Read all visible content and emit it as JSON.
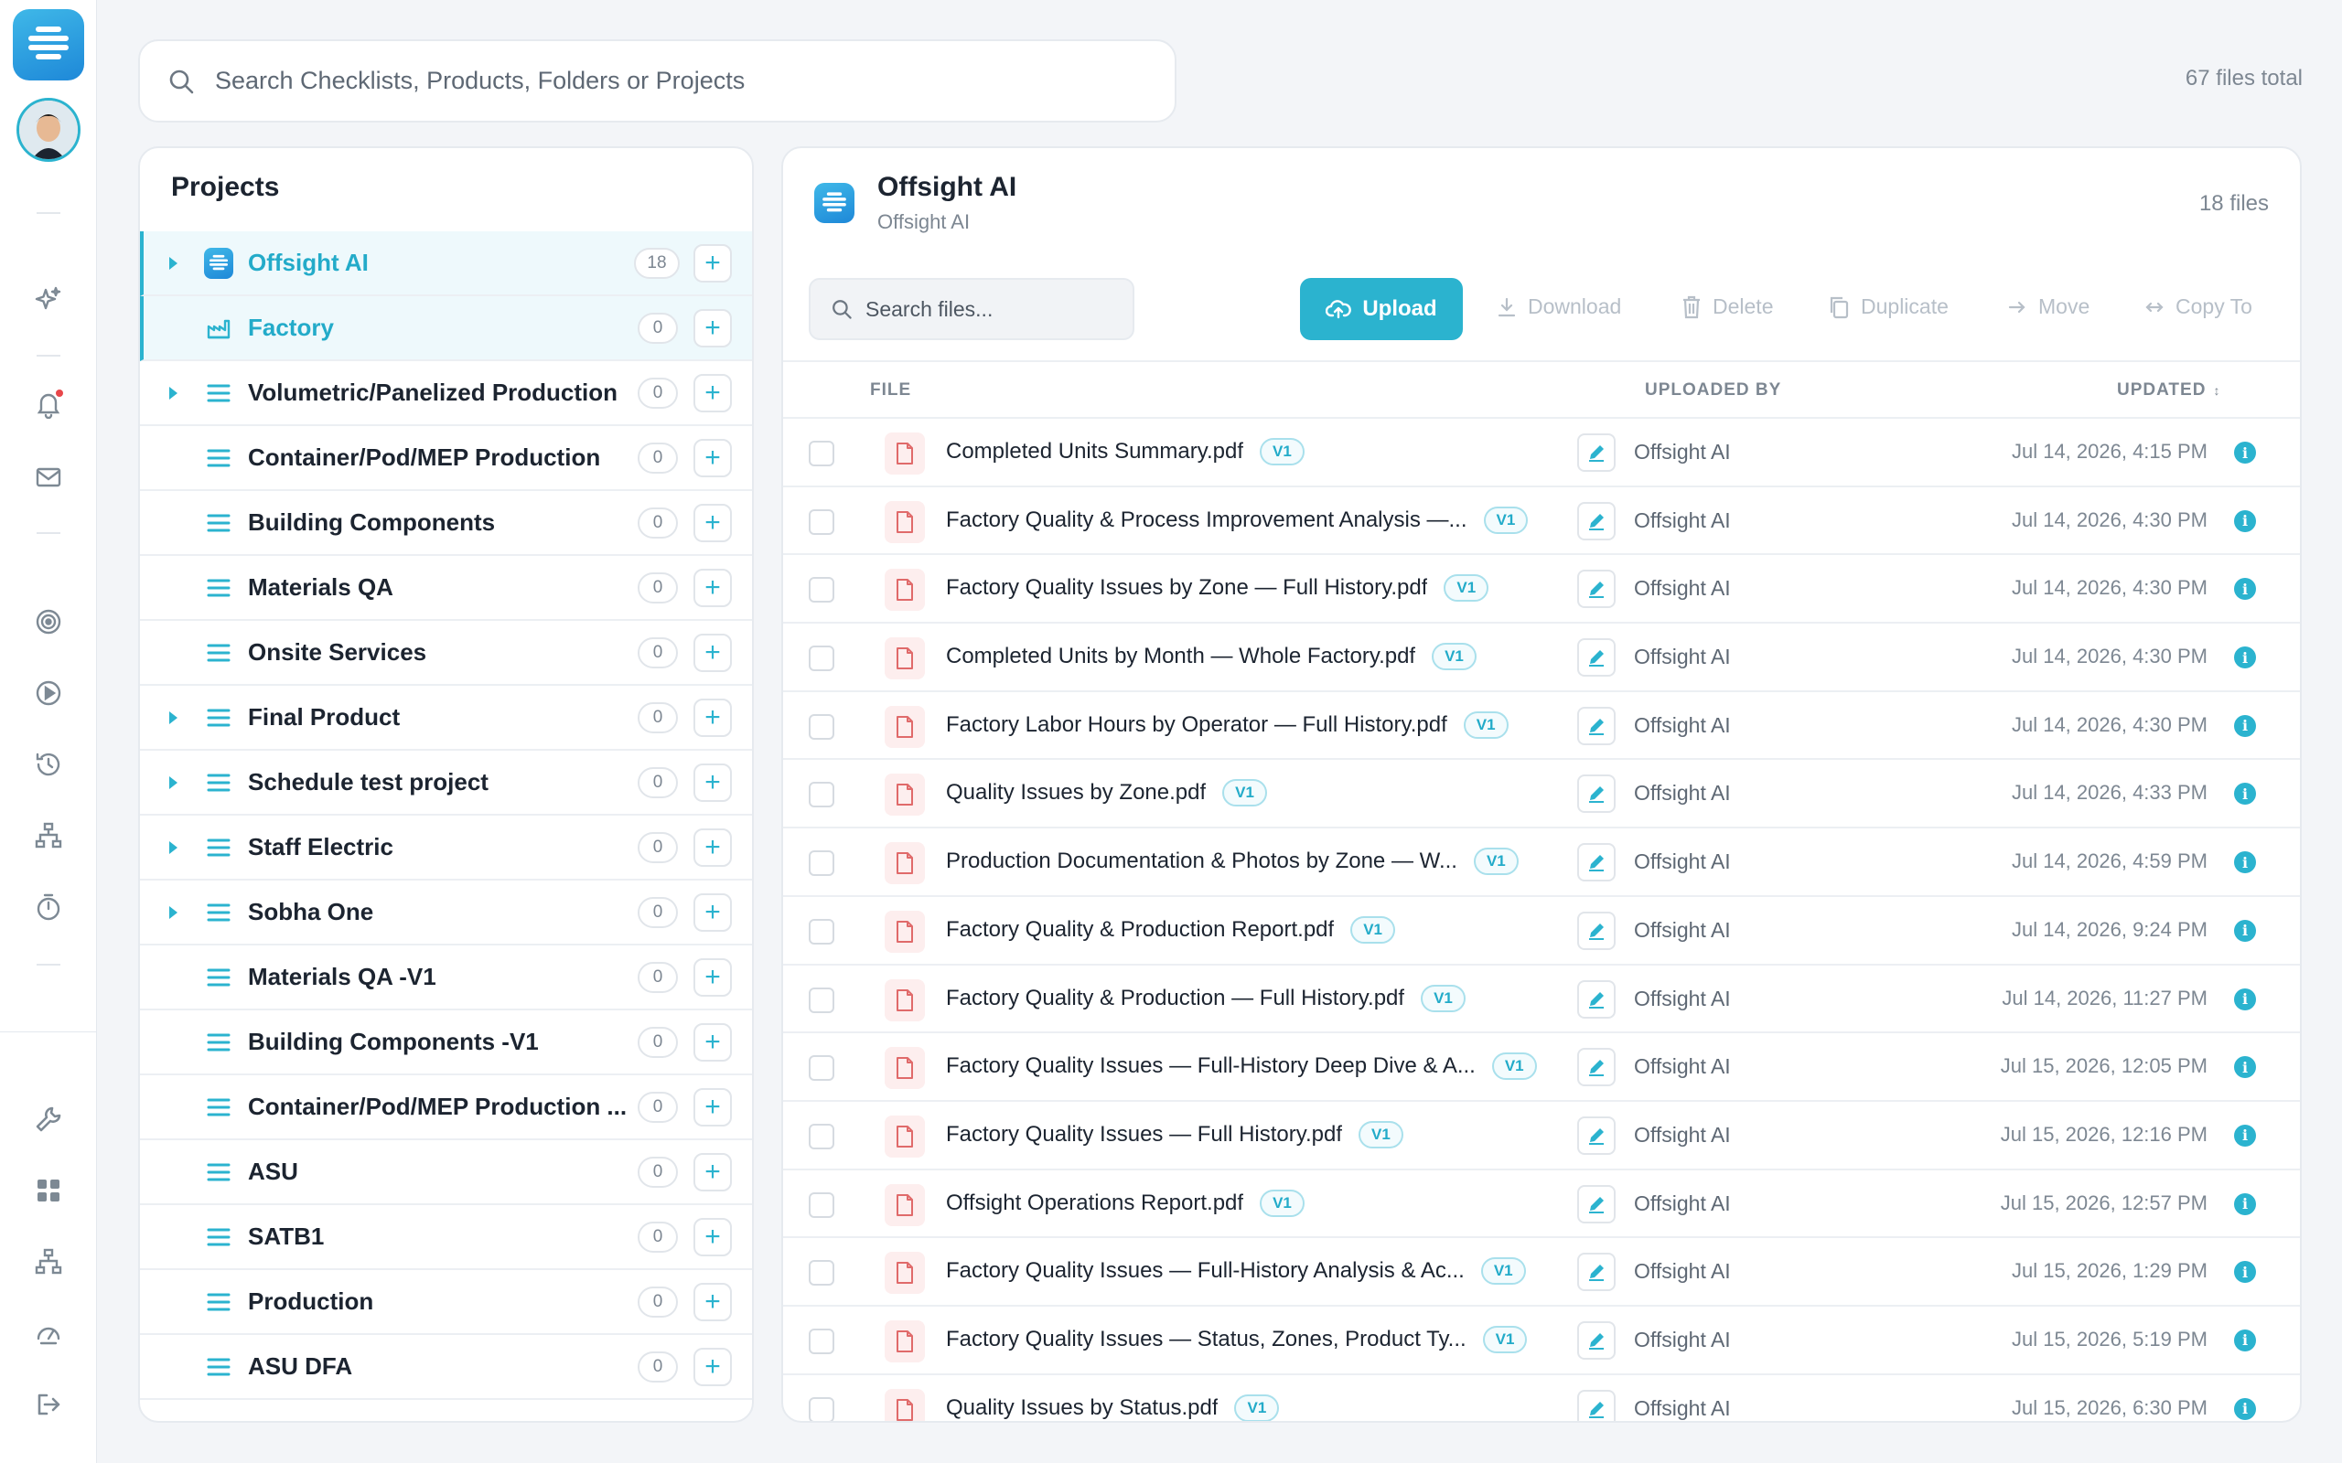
{
  "global_search": {
    "placeholder": "Search Checklists, Products, Folders or Projects"
  },
  "files_total": "67 files total",
  "rail": {
    "icons": [
      "sparkles-icon",
      "bell-icon",
      "mail-icon",
      "target-icon",
      "play-icon",
      "history-icon",
      "org-chart-icon",
      "stopwatch-icon",
      "wrench-icon",
      "grid-icon",
      "org-chart-icon",
      "gauge-icon",
      "logout-icon"
    ]
  },
  "projects": {
    "title": "Projects",
    "items": [
      {
        "name": "Offsight AI",
        "count": "18",
        "expandable": true,
        "icon": "offsight-logo-icon",
        "state": "active"
      },
      {
        "name": "Factory",
        "count": "0",
        "expandable": false,
        "icon": "factory-chart-icon",
        "state": "sub"
      },
      {
        "name": "Volumetric/Panelized Production",
        "count": "0",
        "expandable": true,
        "icon": "list-icon"
      },
      {
        "name": "Container/Pod/MEP Production",
        "count": "0",
        "expandable": false,
        "icon": "list-icon"
      },
      {
        "name": "Building Components",
        "count": "0",
        "expandable": false,
        "icon": "list-icon"
      },
      {
        "name": "Materials QA",
        "count": "0",
        "expandable": false,
        "icon": "list-icon"
      },
      {
        "name": "Onsite Services",
        "count": "0",
        "expandable": false,
        "icon": "list-icon"
      },
      {
        "name": "Final Product",
        "count": "0",
        "expandable": true,
        "icon": "list-icon"
      },
      {
        "name": "Schedule test project",
        "count": "0",
        "expandable": true,
        "icon": "list-icon"
      },
      {
        "name": "Staff Electric",
        "count": "0",
        "expandable": true,
        "icon": "list-icon"
      },
      {
        "name": "Sobha One",
        "count": "0",
        "expandable": true,
        "icon": "list-icon"
      },
      {
        "name": "Materials QA -V1",
        "count": "0",
        "expandable": false,
        "icon": "list-icon"
      },
      {
        "name": "Building Components -V1",
        "count": "0",
        "expandable": false,
        "icon": "list-icon"
      },
      {
        "name": "Container/Pod/MEP Production ...",
        "count": "0",
        "expandable": false,
        "icon": "list-icon"
      },
      {
        "name": "ASU",
        "count": "0",
        "expandable": false,
        "icon": "list-icon"
      },
      {
        "name": "SATB1",
        "count": "0",
        "expandable": false,
        "icon": "list-icon"
      },
      {
        "name": "Production",
        "count": "0",
        "expandable": false,
        "icon": "list-icon"
      },
      {
        "name": "ASU DFA",
        "count": "0",
        "expandable": false,
        "icon": "list-icon"
      }
    ]
  },
  "files_panel": {
    "title": "Offsight AI",
    "subtitle": "Offsight AI",
    "count": "18 files",
    "search_placeholder": "Search files...",
    "toolbar": {
      "upload": "Upload",
      "download": "Download",
      "delete": "Delete",
      "duplicate": "Duplicate",
      "move": "Move",
      "copy_to": "Copy To"
    },
    "columns": {
      "file": "FILE",
      "uploaded_by": "UPLOADED BY",
      "updated": "UPDATED"
    },
    "rows": [
      {
        "name": "Completed Units Summary.pdf",
        "version": "V1",
        "uploader": "Offsight AI",
        "updated": "Jul 14, 2026, 4:15 PM"
      },
      {
        "name": "Factory Quality & Process Improvement Analysis —...",
        "version": "V1",
        "uploader": "Offsight AI",
        "updated": "Jul 14, 2026, 4:30 PM"
      },
      {
        "name": "Factory Quality Issues by Zone — Full History.pdf",
        "version": "V1",
        "uploader": "Offsight AI",
        "updated": "Jul 14, 2026, 4:30 PM"
      },
      {
        "name": "Completed Units by Month — Whole Factory.pdf",
        "version": "V1",
        "uploader": "Offsight AI",
        "updated": "Jul 14, 2026, 4:30 PM"
      },
      {
        "name": "Factory Labor Hours by Operator — Full History.pdf",
        "version": "V1",
        "uploader": "Offsight AI",
        "updated": "Jul 14, 2026, 4:30 PM"
      },
      {
        "name": "Quality Issues by Zone.pdf",
        "version": "V1",
        "uploader": "Offsight AI",
        "updated": "Jul 14, 2026, 4:33 PM"
      },
      {
        "name": "Production Documentation & Photos by Zone — W...",
        "version": "V1",
        "uploader": "Offsight AI",
        "updated": "Jul 14, 2026, 4:59 PM"
      },
      {
        "name": "Factory Quality & Production Report.pdf",
        "version": "V1",
        "uploader": "Offsight AI",
        "updated": "Jul 14, 2026, 9:24 PM"
      },
      {
        "name": "Factory Quality & Production — Full History.pdf",
        "version": "V1",
        "uploader": "Offsight AI",
        "updated": "Jul 14, 2026, 11:27 PM"
      },
      {
        "name": "Factory Quality Issues — Full-History Deep Dive & A...",
        "version": "V1",
        "uploader": "Offsight AI",
        "updated": "Jul 15, 2026, 12:05 PM"
      },
      {
        "name": "Factory Quality Issues — Full History.pdf",
        "version": "V1",
        "uploader": "Offsight AI",
        "updated": "Jul 15, 2026, 12:16 PM"
      },
      {
        "name": "Offsight Operations Report.pdf",
        "version": "V1",
        "uploader": "Offsight AI",
        "updated": "Jul 15, 2026, 12:57 PM"
      },
      {
        "name": "Factory Quality Issues — Full-History Analysis & Ac...",
        "version": "V1",
        "uploader": "Offsight AI",
        "updated": "Jul 15, 2026, 1:29 PM"
      },
      {
        "name": "Factory Quality Issues — Status, Zones, Product Ty...",
        "version": "V1",
        "uploader": "Offsight AI",
        "updated": "Jul 15, 2026, 5:19 PM"
      },
      {
        "name": "Quality Issues by Status.pdf",
        "version": "V1",
        "uploader": "Offsight AI",
        "updated": "Jul 15, 2026, 6:30 PM"
      }
    ]
  },
  "colors": {
    "accent": "#2bb3cf",
    "pdf_red": "#e06a6a",
    "notification": "#e8474b"
  }
}
